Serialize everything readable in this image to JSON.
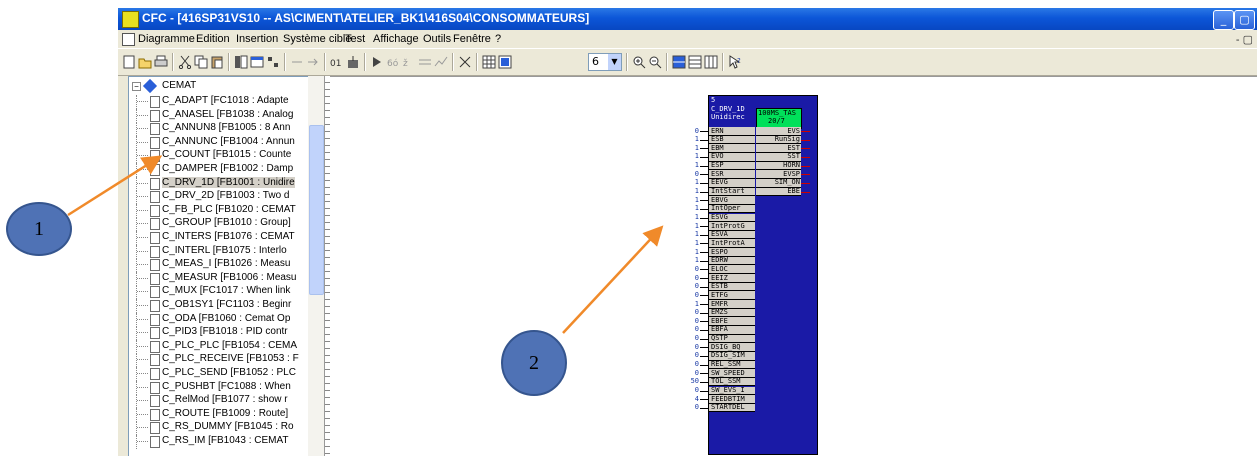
{
  "window": {
    "title": "CFC - [416SP31VS10 -- AS\\CIMENT\\ATELIER_BK1\\416S04\\CONSOMMATEURS]",
    "controls": [
      "_",
      "▢"
    ]
  },
  "menu": [
    "Diagramme",
    "Edition",
    "Insertion",
    "Système cible",
    "Test",
    "Affichage",
    "Outils",
    "Fenêtre",
    "?"
  ],
  "mdi_controls": "- ▢",
  "toolbar": {
    "zoom_value": "6"
  },
  "tree": {
    "root": "CEMAT",
    "items": [
      "C_ADAPT [FC1018 : Adapte",
      "C_ANASEL [FB1038 : Analog",
      "C_ANNUN8 [FB1005 : 8 Ann",
      "C_ANNUNC [FB1004 : Annun",
      "C_COUNT [FB1015 : Counte",
      "C_DAMPER [FB1002 : Damp",
      "C_DRV_1D [FB1001 : Unidire",
      "C_DRV_2D [FB1003 : Two d",
      "C_FB_PLC [FB1020 : CEMAT",
      "C_GROUP [FB1010 : Group]",
      "C_INTERS [FB1076 : CEMAT",
      "C_INTERL [FB1075 : Interlo",
      "C_MEAS_I [FB1026 : Measu",
      "C_MEASUR [FB1006 : Measu",
      "C_MUX [FC1017 : When link",
      "C_OB1SY1 [FC1103 : Beginr",
      "C_ODA [FB1060 : Cemat Op",
      "C_PID3 [FB1018 : PID contr",
      "C_PLC_PLC [FB1054 : CEMA",
      "C_PLC_RECEIVE [FB1053 : F",
      "C_PLC_SEND [FB1052 : PLC",
      "C_PUSHBT [FC1088 : When",
      "C_RelMod [FB1077 : show r",
      "C_ROUTE [FB1009 : Route]",
      "C_RS_DUMMY [FB1045 : Ro",
      "C_RS_IM [FB1043 : CEMAT"
    ],
    "selected_index": 6
  },
  "block": {
    "number": "5",
    "name": "C_DRV_1D",
    "comment": "Unidirec",
    "task": "100MS_TAS",
    "order": "20/7",
    "inputs": [
      {
        "value": "0",
        "name": "ERN"
      },
      {
        "value": "1",
        "name": "ESB"
      },
      {
        "value": "1",
        "name": "EBM"
      },
      {
        "value": "1",
        "name": "EVO"
      },
      {
        "value": "1",
        "name": "ESP"
      },
      {
        "value": "0",
        "name": "ESR"
      },
      {
        "value": "1",
        "name": "EEVG"
      },
      {
        "value": "1",
        "name": "IntStart"
      },
      {
        "value": "1",
        "name": "EBVG"
      },
      {
        "value": "1",
        "name": "IntOper"
      },
      {
        "value": "1",
        "name": "ESVG"
      },
      {
        "value": "1",
        "name": "IntProtG"
      },
      {
        "value": "1",
        "name": "ESVA"
      },
      {
        "value": "1",
        "name": "IntProtA"
      },
      {
        "value": "1",
        "name": "ESPO"
      },
      {
        "value": "1",
        "name": "EDRW"
      },
      {
        "value": "0",
        "name": "ELOC"
      },
      {
        "value": "0",
        "name": "EEIZ"
      },
      {
        "value": "0",
        "name": "ESTB"
      },
      {
        "value": "0",
        "name": "ETFG"
      },
      {
        "value": "1",
        "name": "EMFR"
      },
      {
        "value": "0",
        "name": "EMZS"
      },
      {
        "value": "0",
        "name": "EBFE"
      },
      {
        "value": "0",
        "name": "EBFA"
      },
      {
        "value": "0",
        "name": "QSTP"
      },
      {
        "value": "0",
        "name": "DSIG_BQ"
      },
      {
        "value": "0",
        "name": "DSIG_SIM"
      },
      {
        "value": "0",
        "name": "REL_SSM"
      },
      {
        "value": "0",
        "name": "SW_SPEED"
      },
      {
        "value": "50",
        "name": "TOL_SSM"
      },
      {
        "value": "0",
        "name": "SW_EVS_I"
      },
      {
        "value": "4",
        "name": "FEEDBTIM"
      },
      {
        "value": "0",
        "name": "STARTDEL"
      }
    ],
    "outputs": [
      "EVS",
      "RunSig",
      "EST",
      "SST",
      "HORN",
      "EVSP",
      "SIM_ON",
      "EBE"
    ]
  },
  "annotations": [
    {
      "label": "1"
    },
    {
      "label": "2"
    }
  ],
  "colors": {
    "block_blue": "#1a1aa6",
    "task_green": "#00e05a",
    "arrow_orange": "#f08a2a",
    "circle_blue": "#4f72b5"
  }
}
